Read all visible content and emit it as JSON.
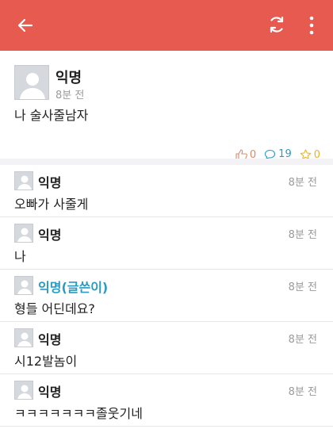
{
  "colors": {
    "accent": "#e65a50",
    "op_author": "#2a9bc2",
    "like": "#d98a6a",
    "comment": "#2a9bc2",
    "star": "#e6b52e"
  },
  "appbar": {
    "back_icon": "arrow-left-icon",
    "refresh_icon": "refresh-icon",
    "more_icon": "more-vertical-icon"
  },
  "post": {
    "author": "익명",
    "time": "8분 전",
    "content": "나 술사줄남자",
    "likes": "0",
    "comments": "19",
    "scraps": "0"
  },
  "comments": [
    {
      "author": "익명",
      "time": "8분 전",
      "text": "오빠가 사줄게"
    },
    {
      "author": "익명",
      "time": "8분 전",
      "text": "나"
    },
    {
      "author": "익명(글쓴이)",
      "time": "8분 전",
      "text": "형들 어딘데요?"
    },
    {
      "author": "익명",
      "time": "8분 전",
      "text": "시12발놈이"
    },
    {
      "author": "익명",
      "time": "8분 전",
      "text": "ㅋㅋㅋㅋㅋㅋㅋ졸웃기네"
    }
  ]
}
